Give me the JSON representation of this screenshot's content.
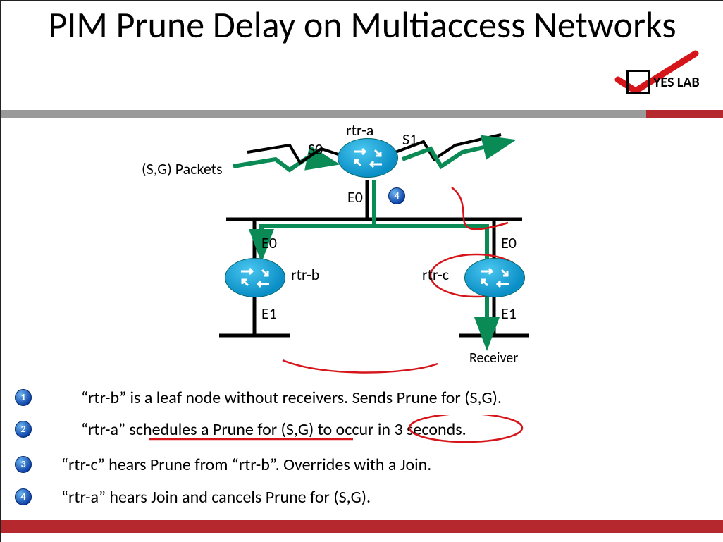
{
  "title": "PIM Prune Delay on Multiaccess Networks",
  "logo_text": "YES LAB",
  "sg_packets": "(S,G) Packets",
  "routers": {
    "a": {
      "name": "rtr-a",
      "if_s0": "S0",
      "if_s1": "S1",
      "if_e0": "E0"
    },
    "b": {
      "name": "rtr-b",
      "if_e0": "E0",
      "if_e1": "E1"
    },
    "c": {
      "name": "rtr-c",
      "if_e0": "E0",
      "if_e1": "E1"
    }
  },
  "receiver": "Receiver",
  "diagram_badge": "4",
  "steps": [
    {
      "num": "1",
      "text": "“rtr-b” is a leaf node without receivers.  Sends Prune for (S,G)."
    },
    {
      "num": "2",
      "text": "“rtr-a” schedules a Prune for (S,G) to occur in 3 seconds."
    },
    {
      "num": "3",
      "text": "“rtr-c” hears Prune from “rtr-b”.  Overrides with a Join."
    },
    {
      "num": "4",
      "text": "“rtr-a” hears Join and cancels Prune for (S,G)."
    }
  ]
}
